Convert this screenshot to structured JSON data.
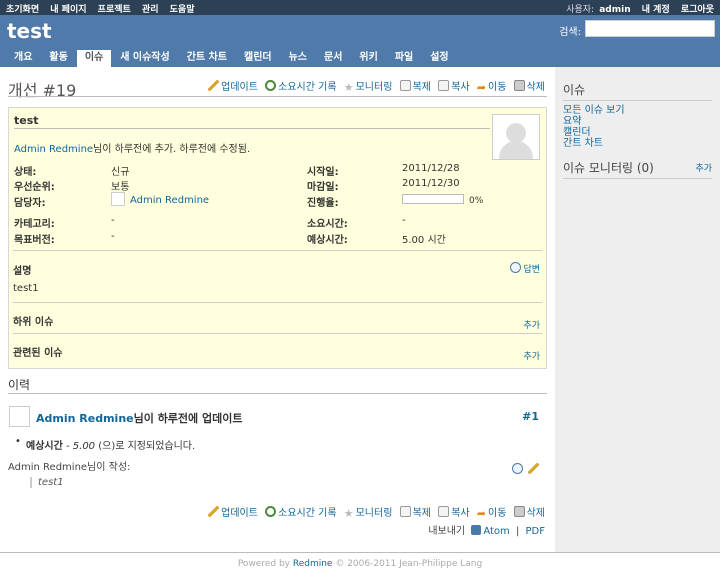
{
  "top_menu": {
    "items": [
      "초기화면",
      "내 페이지",
      "프로젝트",
      "관리",
      "도움말"
    ],
    "user_label": "사용자:",
    "user_name": "admin",
    "account": "내 계정",
    "logout": "로그아웃"
  },
  "header": {
    "project": "test",
    "search_label": "검색:",
    "search_value": ""
  },
  "tabs": [
    "개요",
    "활동",
    "이슈",
    "새 이슈작성",
    "간트 차트",
    "캘린더",
    "뉴스",
    "문서",
    "위키",
    "파일",
    "설정"
  ],
  "selected_tab": "이슈",
  "issue_title": "개선 #19",
  "actions": {
    "update": "업데이트",
    "log_time": "소요시간 기록",
    "watch": "모니터링",
    "duplicate": "복제",
    "copy": "복사",
    "move": "이동",
    "delete": "삭제"
  },
  "issue": {
    "subject": "test",
    "author_name": "Admin Redmine",
    "author_text": "님이 하루전에 추가. 하루전에 수정됨.",
    "status_label": "상태:",
    "status": "신규",
    "priority_label": "우선순위:",
    "priority": "보통",
    "assignee_label": "담당자:",
    "assignee": "Admin Redmine",
    "category_label": "카테고리:",
    "category": "-",
    "target_label": "목표버전:",
    "target": "-",
    "start_label": "시작일:",
    "start": "2011/12/28",
    "due_label": "마감일:",
    "due": "2011/12/30",
    "done_label": "진행율:",
    "done": "0%",
    "done_ratio": 0,
    "spent_label": "소요시간:",
    "spent": "-",
    "estimated_label": "예상시간:",
    "estimated": "5.00 시간",
    "description_label": "설명",
    "reply": "답변",
    "description": "test1",
    "subtasks_label": "하위 이슈",
    "related_label": "관련된 이슈",
    "add": "추가"
  },
  "history": {
    "title": "이력",
    "author": "Admin Redmine",
    "text_mid": "님이 ",
    "time_link": "하루전에",
    "text_end": " 업데이트",
    "number": "#1",
    "detail_field": "예상시간",
    "detail_sep": " - ",
    "detail_value": "5.00",
    "detail_text": " (으)로 지정되었습니다.",
    "quote_by": "Admin Redmine님이 작성:",
    "quote": "test1"
  },
  "export": {
    "label": "내보내기",
    "atom": "Atom",
    "sep": "|",
    "pdf": "PDF"
  },
  "sidebar": {
    "issues_title": "이슈",
    "links": [
      "모든 이슈 보기",
      "요약",
      "캘린더",
      "간트 차트"
    ],
    "watchers_title": "이슈 모니터링 (0)",
    "add": "추가"
  },
  "footer": {
    "prefix": "Powered by ",
    "link": "Redmine",
    "suffix": " © 2006-2011 Jean-Philippe Lang"
  }
}
